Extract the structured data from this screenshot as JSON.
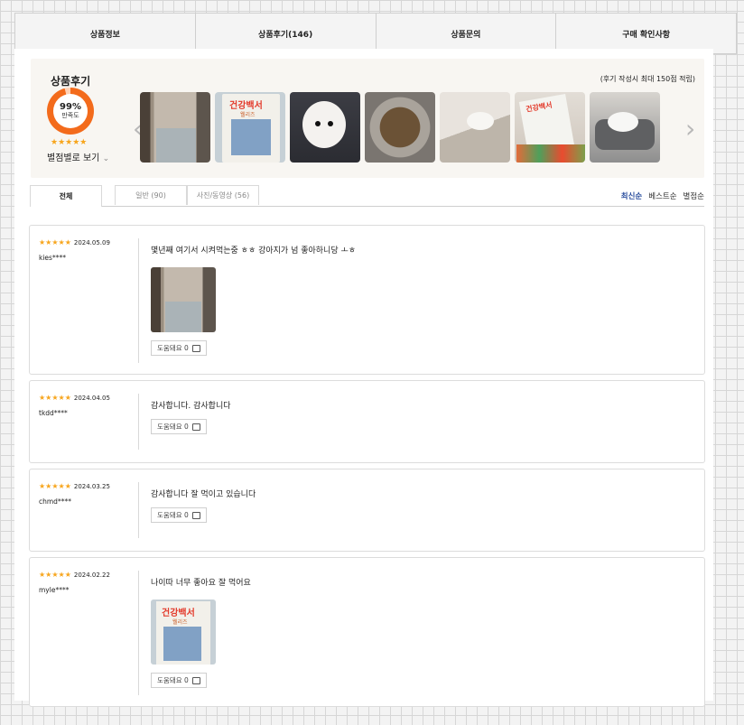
{
  "tabs": [
    "상품정보",
    "상품후기(146)",
    "상품문의",
    "구매 확인사항"
  ],
  "summary": {
    "title": "상품후기",
    "satisfaction_pct": "99%",
    "satisfaction_label": "만족도",
    "satisfaction_value": 0.99,
    "stars": "★★★★★",
    "by_rating": "별점별로 보기",
    "notice": "(후기 작성시 최대 150점 적립)",
    "prev_arrow": "‹",
    "next_arrow": "›"
  },
  "review_tabs": [
    "전체",
    "일반 (90)",
    "사진/동영상 (56)"
  ],
  "sort_options": [
    "최신순",
    "베스트순",
    "별점순"
  ],
  "reviews": [
    {
      "stars": "★★★★★",
      "stars_off": "",
      "date": "2024.05.09",
      "user": "kies****",
      "text": "몇년째 여기서 시켜먹는중 ㅎㅎ 강아지가 넘 좋아하니당 ㅗㅎ",
      "helpful": "도움돼요 0"
    },
    {
      "stars": "★★★★★",
      "stars_off": "",
      "date": "2024.04.05",
      "user": "tkdd****",
      "text": "감사합니다. 감사합니다",
      "helpful": "도움돼요 0"
    },
    {
      "stars": "★★★",
      "stars_off": "★★",
      "date": "2024.03.25",
      "user": "chmd****",
      "text": "감사합니다 잘 먹이고 있습니다",
      "helpful": "도움돼요 0"
    },
    {
      "stars": "★★★★★",
      "stars_off": "",
      "date": "2024.02.22",
      "user": "myle****",
      "text": "나이따 너무 좋아요 잘 먹어요",
      "helpful": "도움돼요 0"
    }
  ],
  "bag_label": "건강백서",
  "bag_sub": "웰리즈",
  "colors": {
    "accent_orange": "#f36b1c",
    "star": "#f7a51c",
    "sort_active": "#2a4e9e"
  }
}
